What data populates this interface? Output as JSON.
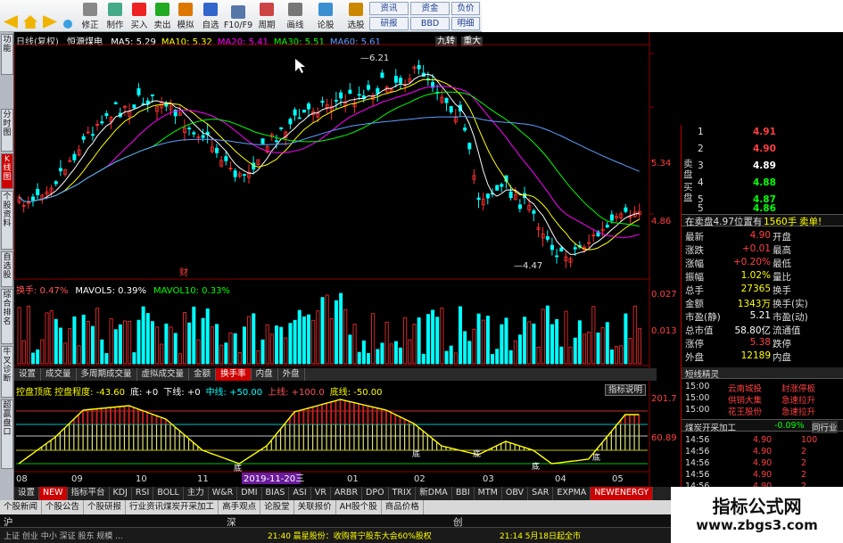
{
  "toolbar": {
    "buttons": [
      "修正",
      "制作",
      "买入",
      "卖出",
      "模拟",
      "自选",
      "F10/F9",
      "周期",
      "画线",
      "论股",
      "选股"
    ],
    "right_buttons": [
      "资讯",
      "资金",
      "负价",
      "研报",
      "BBD",
      "明细"
    ]
  },
  "left_tabs": [
    "功能",
    "分时图",
    "K线图",
    "个股资料",
    "自选股",
    "综合排名",
    "牛叉诊断",
    "超赢盘口"
  ],
  "chart": {
    "header_prefix": "日线(复权)",
    "stock_name": "恒源煤电",
    "ma": [
      {
        "label": "MA5: 5.29",
        "color": "#ffffff"
      },
      {
        "label": "MA10: 5.32",
        "color": "#ffff00"
      },
      {
        "label": "MA20: 5.41",
        "color": "#ff00ff"
      },
      {
        "label": "MA30: 5.51",
        "color": "#00ff00"
      },
      {
        "label": "MA60: 5.61",
        "color": "#5f9fff"
      }
    ],
    "header_right": [
      "九转",
      "重大"
    ],
    "high_label": "6.21",
    "low_label": "4.47",
    "cai_label": "财",
    "price_axis": [
      "5.34",
      "4.86"
    ],
    "date_labels": [
      "08",
      "09",
      "10",
      "11",
      "12",
      "01",
      "02",
      "03",
      "04",
      "05"
    ],
    "date_highlight": "2019-11-20三",
    "tags": [
      "底",
      "底",
      "底",
      "底",
      "底"
    ]
  },
  "volume": {
    "header": [
      {
        "label": "换手: 0.47%",
        "color": "#ff5555"
      },
      {
        "label": "MAVOL5: 0.39%",
        "color": "#ffffff"
      },
      {
        "label": "MAVOL10: 0.33%",
        "color": "#00ff00"
      }
    ],
    "axis": [
      "0.027",
      "0.013"
    ]
  },
  "tabs_mid": [
    "设置",
    "成交量",
    "多周期成交量",
    "虚拟成交量",
    "金额",
    "换手率",
    "内盘",
    "外盘"
  ],
  "tabs_mid_active": "换手率",
  "indicator": {
    "header": [
      {
        "label": "控盘顶底 控盘程度: -43.60",
        "color": "#ffff00"
      },
      {
        "label": "底: +0",
        "color": "#ffffff"
      },
      {
        "label": "下线: +0",
        "color": "#ffffff"
      },
      {
        "label": "中线: +50.00",
        "color": "#00ffff"
      },
      {
        "label": "上线: +100.0",
        "color": "#ff5555"
      },
      {
        "label": "底线: -50.00",
        "color": "#ffff00"
      }
    ],
    "explain_button": "指标说明",
    "axis": [
      "201.7",
      "60.89"
    ]
  },
  "orderbook": {
    "sell_label": "卖盘",
    "buy_label": "买盘",
    "sell": [
      {
        "level": "1",
        "price": "4.91"
      },
      {
        "level": "2",
        "price": "4.90"
      },
      {
        "level": "3",
        "price": "4.89"
      },
      {
        "level": "4",
        "price": "4.88"
      },
      {
        "level": "5",
        "price": "4.87"
      }
    ],
    "buy": [
      {
        "level": "5",
        "price": "4.86"
      }
    ],
    "summary_left": "在卖盘4.97位置有",
    "summary_mid": "1560手",
    "summary_right": "卖单!",
    "quotes": [
      {
        "l": "最新",
        "v": "4.90",
        "r": "开盘"
      },
      {
        "l": "涨跌",
        "v": "+0.01",
        "r": "最高"
      },
      {
        "l": "涨幅",
        "v": "+0.20%",
        "r": "最低"
      },
      {
        "l": "振幅",
        "v": "1.02%",
        "r": "量比"
      },
      {
        "l": "总手",
        "v": "27365",
        "r": "换手"
      },
      {
        "l": "金额",
        "v": "1343万",
        "r": "换手(实)"
      },
      {
        "l": "市盈(静)",
        "v": "5.21",
        "r": "市盈(动)"
      },
      {
        "l": "总市值",
        "v": "58.80亿",
        "r": "流通值"
      },
      {
        "l": "涨停",
        "v": "5.38",
        "r": "跌停"
      },
      {
        "l": "外盘",
        "v": "12189",
        "r": "内盘"
      }
    ],
    "news_header": "短线精灵",
    "news": [
      {
        "time": "15:00",
        "name": "云南城投",
        "act": "封涨停板"
      },
      {
        "time": "15:00",
        "name": "供销大集",
        "act": "急速拉升"
      },
      {
        "time": "15:00",
        "name": "花王股份",
        "act": "急速拉升"
      }
    ],
    "sector": "煤炭开采加工",
    "sector_change": "-0.09%",
    "sector_tab": "同行业",
    "ticks": [
      {
        "time": "14:56",
        "price": "4.90",
        "vol": "100"
      },
      {
        "time": "14:56",
        "price": "4.90",
        "vol": "2"
      },
      {
        "time": "14:56",
        "price": "4.90",
        "vol": "2"
      },
      {
        "time": "14:56",
        "price": "4.90",
        "vol": "2"
      },
      {
        "time": "14:56",
        "price": "4.90",
        "vol": "2"
      }
    ]
  },
  "bottom_tabs": [
    "设置",
    "NEW",
    "指标平台",
    "KDJ",
    "RSI",
    "BOLL",
    "主力",
    "W&R",
    "DMI",
    "BIAS",
    "ASI",
    "VR",
    "ARBR",
    "DPO",
    "TRIX",
    "新DMA",
    "BBI",
    "MTM",
    "OBV",
    "SAR",
    "EXPMA",
    "NEWENERGY"
  ],
  "bottom_active": "NEWENERGY",
  "link_tabs": [
    "个股新闻",
    "个股公告",
    "个股研报",
    "行业资讯煤炭开采加工",
    "高手观点",
    "论股堂",
    "关联报价",
    "AH股个股",
    "商品价格"
  ],
  "status": {
    "labels": [
      "沪",
      "深",
      "创"
    ],
    "ticker_left": "上证  创业  中小  深证  股东  规模  ...",
    "ticker_news1": "21:40 晨星股份：收购普宁股东大会60%股权",
    "ticker_news2": "21:14 5月18日起全市",
    "logo_title": "指标公式网",
    "logo_url": "www.zbgs3.com"
  }
}
